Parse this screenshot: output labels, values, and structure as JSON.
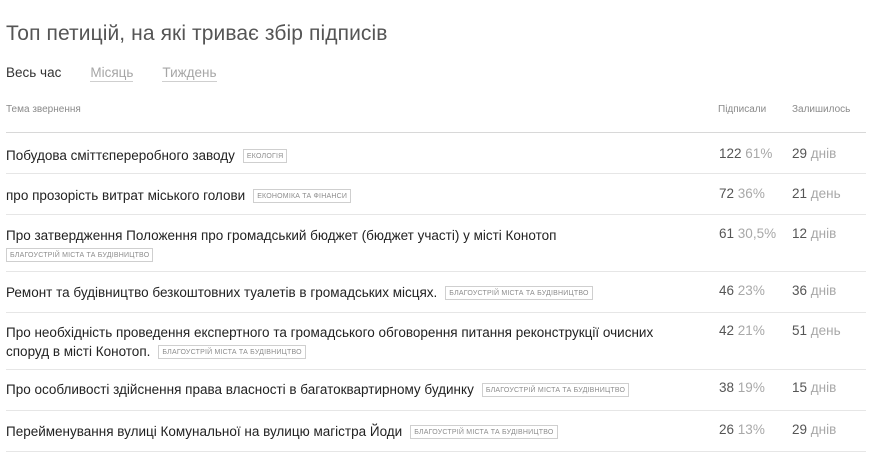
{
  "page": {
    "title": "Топ петицій, на які триває збір підписів"
  },
  "filters": [
    {
      "label": "Весь час",
      "active": true
    },
    {
      "label": "Місяць",
      "active": false
    },
    {
      "label": "Тиждень",
      "active": false
    }
  ],
  "table": {
    "headers": {
      "topic": "Тема звернення",
      "signed": "Підписали",
      "remaining": "Залишилось"
    },
    "rows": [
      {
        "title": "Побудова сміттєпереробного заводу",
        "tag": "Екологія",
        "signed": "122",
        "percent": "61%",
        "remaining": "29",
        "unit": "днів"
      },
      {
        "title": "про прозорість витрат міського голови",
        "tag": "Економіка та фінанси",
        "signed": "72",
        "percent": "36%",
        "remaining": "21",
        "unit": "день"
      },
      {
        "title": "Про затвердження Положення про громадський бюджет (бюджет участі) у місті Конотоп",
        "tag": "Благоустрій міста та будівництво",
        "signed": "61",
        "percent": "30,5%",
        "remaining": "12",
        "unit": "днів"
      },
      {
        "title": "Ремонт та будівництво безкоштовних туалетів в громадських місцях.",
        "tag": "Благоустрій міста та будівництво",
        "signed": "46",
        "percent": "23%",
        "remaining": "36",
        "unit": "днів"
      },
      {
        "title": "Про необхідність проведення експертного та громадського обговорення питання реконструкції очисних споруд в місті Конотоп.",
        "tag": "Благоустрій міста та будівництво",
        "signed": "42",
        "percent": "21%",
        "remaining": "51",
        "unit": "день"
      },
      {
        "title": "Про особливості здійснення права власності в багатоквартирному будинку",
        "tag": "Благоустрій міста та будівництво",
        "signed": "38",
        "percent": "19%",
        "remaining": "15",
        "unit": "днів"
      },
      {
        "title": "Перейменування вулиці Комунальної на вулицю магістра Йоди",
        "tag": "Благоустрій міста та будівництво",
        "signed": "26",
        "percent": "13%",
        "remaining": "29",
        "unit": "днів"
      }
    ]
  }
}
